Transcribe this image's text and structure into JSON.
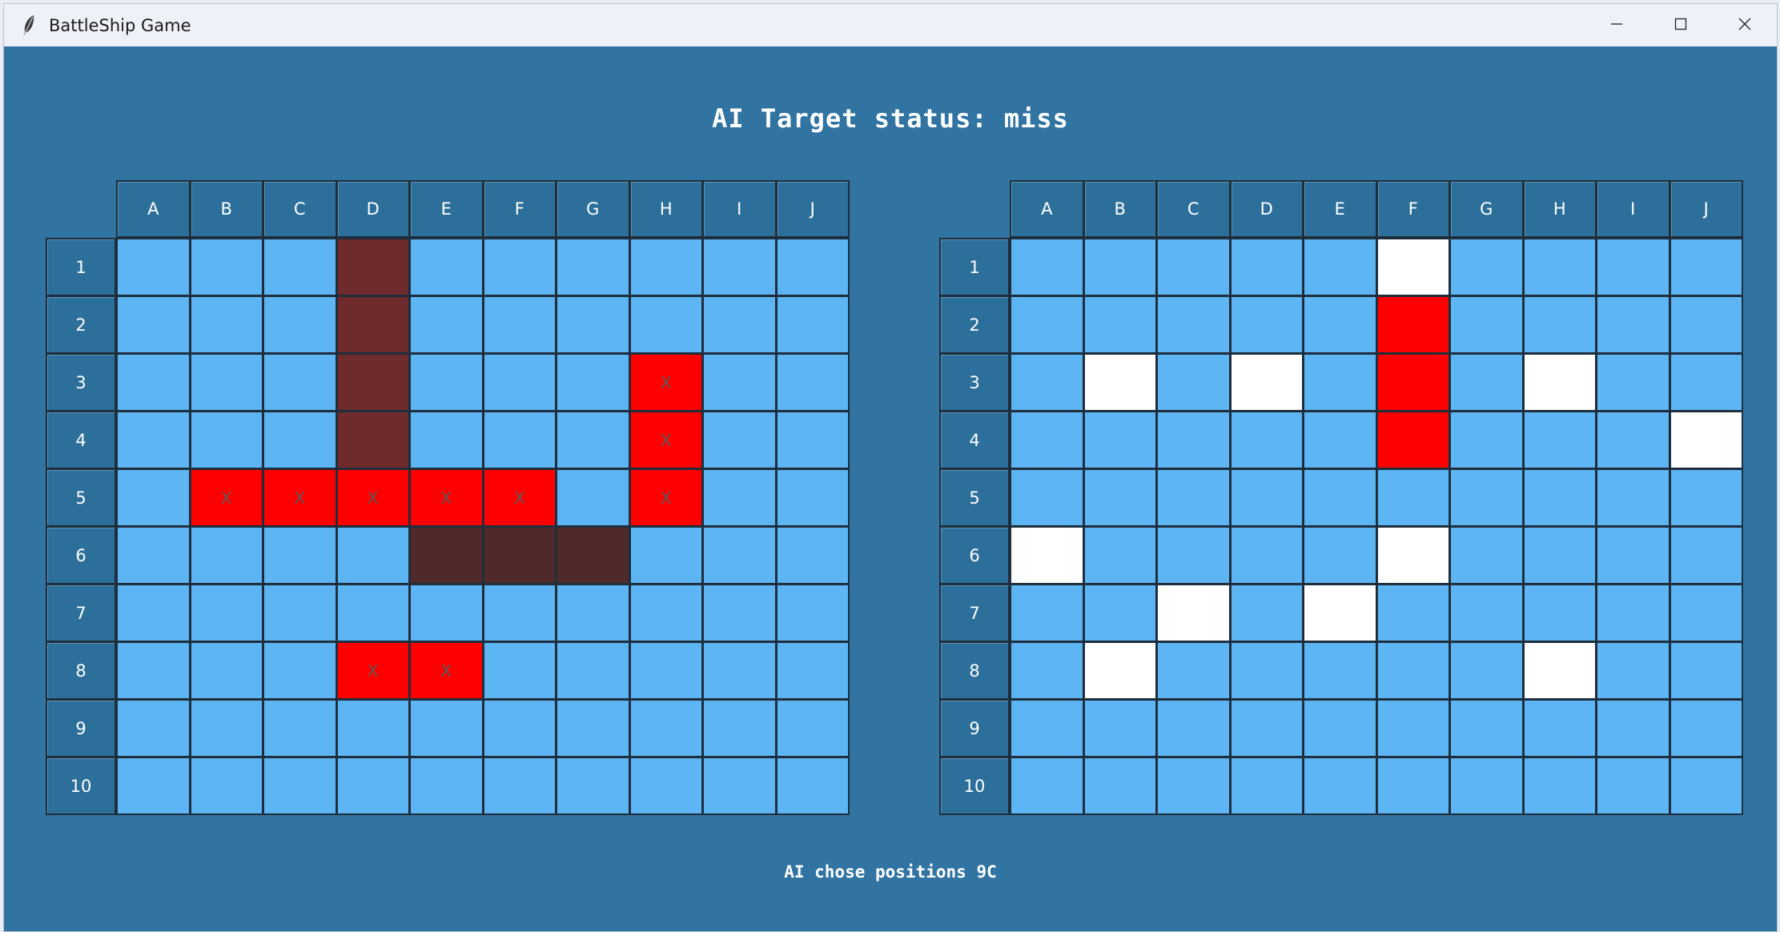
{
  "window": {
    "title": "BattleShip Game",
    "icon": "feather-icon",
    "controls": [
      "minimize-icon",
      "maximize-icon",
      "close-icon"
    ]
  },
  "status_title": "AI Target status: miss",
  "bottom_message": "AI chose positions 9C",
  "columns": [
    "A",
    "B",
    "C",
    "D",
    "E",
    "F",
    "G",
    "H",
    "I",
    "J"
  ],
  "rows": [
    "1",
    "2",
    "3",
    "4",
    "5",
    "6",
    "7",
    "8",
    "9",
    "10"
  ],
  "colors": {
    "background": "#3174a2",
    "water": "#5db5f3",
    "hit": "#ff0000",
    "ship": "#6f2b2c",
    "ship_dark": "#50292a",
    "miss": "#ffffff",
    "header": "#2d6f9b"
  },
  "player_board": {
    "cells": [
      [
        "",
        "",
        "",
        "ship",
        "",
        "",
        "",
        "",
        "",
        ""
      ],
      [
        "",
        "",
        "",
        "ship",
        "",
        "",
        "",
        "",
        "",
        ""
      ],
      [
        "",
        "",
        "",
        "ship",
        "",
        "",
        "",
        "hit",
        "",
        ""
      ],
      [
        "",
        "",
        "",
        "ship",
        "",
        "",
        "",
        "hit",
        "",
        ""
      ],
      [
        "",
        "hit",
        "hit",
        "hit",
        "hit",
        "hit",
        "",
        "hit",
        "",
        ""
      ],
      [
        "",
        "",
        "",
        "",
        "ship-dark",
        "ship-dark",
        "ship-dark",
        "",
        "",
        ""
      ],
      [
        "",
        "",
        "",
        "",
        "",
        "",
        "",
        "",
        "",
        ""
      ],
      [
        "",
        "",
        "",
        "hit",
        "hit",
        "",
        "",
        "",
        "",
        ""
      ],
      [
        "",
        "",
        "",
        "",
        "",
        "",
        "",
        "",
        "",
        ""
      ],
      [
        "",
        "",
        "",
        "",
        "",
        "",
        "",
        "",
        "",
        ""
      ]
    ],
    "hit_mark": "X"
  },
  "enemy_board": {
    "cells": [
      [
        "",
        "",
        "",
        "",
        "",
        "miss",
        "",
        "",
        "",
        ""
      ],
      [
        "",
        "",
        "",
        "",
        "",
        "hit",
        "",
        "",
        "",
        ""
      ],
      [
        "",
        "miss",
        "",
        "miss",
        "",
        "hit",
        "",
        "miss",
        "",
        ""
      ],
      [
        "",
        "",
        "",
        "",
        "",
        "hit",
        "",
        "",
        "",
        "miss"
      ],
      [
        "",
        "",
        "",
        "",
        "",
        "",
        "",
        "",
        "",
        ""
      ],
      [
        "miss",
        "",
        "",
        "",
        "",
        "miss",
        "",
        "",
        "",
        ""
      ],
      [
        "",
        "",
        "miss",
        "",
        "miss",
        "",
        "",
        "",
        "",
        ""
      ],
      [
        "",
        "miss",
        "",
        "",
        "",
        "",
        "",
        "miss",
        "",
        ""
      ],
      [
        "",
        "",
        "",
        "",
        "",
        "",
        "",
        "",
        "",
        ""
      ],
      [
        "",
        "",
        "",
        "",
        "",
        "",
        "",
        "",
        "",
        ""
      ]
    ],
    "hit_mark": ""
  }
}
